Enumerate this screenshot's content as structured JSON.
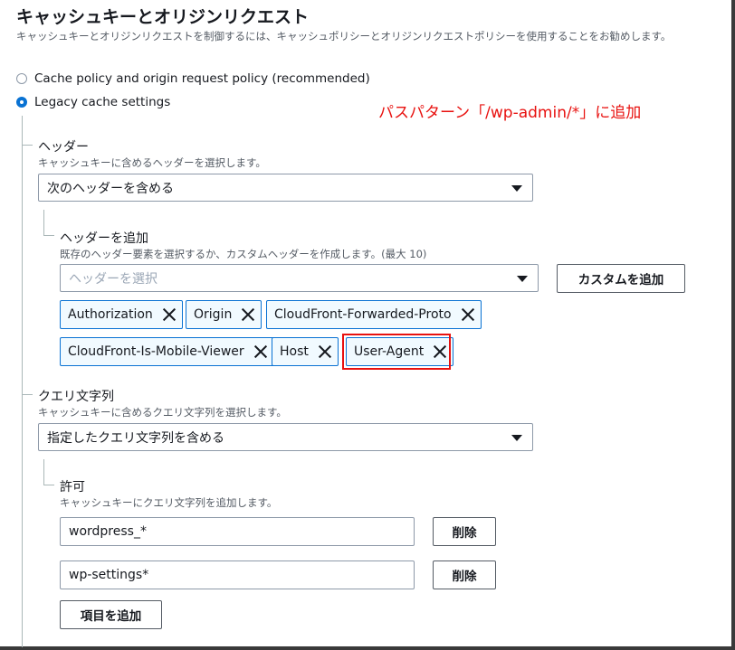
{
  "page": {
    "title": "キャッシュキーとオリジンリクエスト",
    "description": "キャッシュキーとオリジンリクエストを制御するには、キャッシュポリシーとオリジンリクエストポリシーを使用することをお勧めします。"
  },
  "options": {
    "policy": "Cache policy and origin request policy (recommended)",
    "legacy": "Legacy cache settings"
  },
  "annotation": "パスパターン「/wp-admin/*」に追加",
  "headers": {
    "label": "ヘッダー",
    "description": "キャッシュキーに含めるヘッダーを選択します。",
    "select_value": "次のヘッダーを含める",
    "add": {
      "label": "ヘッダーを追加",
      "description": "既存のヘッダー要素を選択するか、カスタムヘッダーを作成します。(最大 10)",
      "placeholder": "ヘッダーを選択",
      "custom_button": "カスタムを追加"
    },
    "tokens": [
      "Authorization",
      "Origin",
      "CloudFront-Forwarded-Proto",
      "CloudFront-Is-Mobile-Viewer",
      "Host",
      "User-Agent"
    ]
  },
  "query": {
    "label": "クエリ文字列",
    "description": "キャッシュキーに含めるクエリ文字列を選択します。",
    "select_value": "指定したクエリ文字列を含める",
    "allow": {
      "label": "許可",
      "description": "キャッシュキーにクエリ文字列を追加します。",
      "items": [
        "wordpress_*",
        "wp-settings*"
      ],
      "remove_label": "削除",
      "add_item_label": "項目を追加"
    }
  },
  "colors": {
    "accent": "#0972d3",
    "annotation": "#e8110f"
  },
  "icons": [
    "radio-unchecked-icon",
    "radio-checked-icon",
    "caret-down-icon",
    "remove-token-icon"
  ]
}
